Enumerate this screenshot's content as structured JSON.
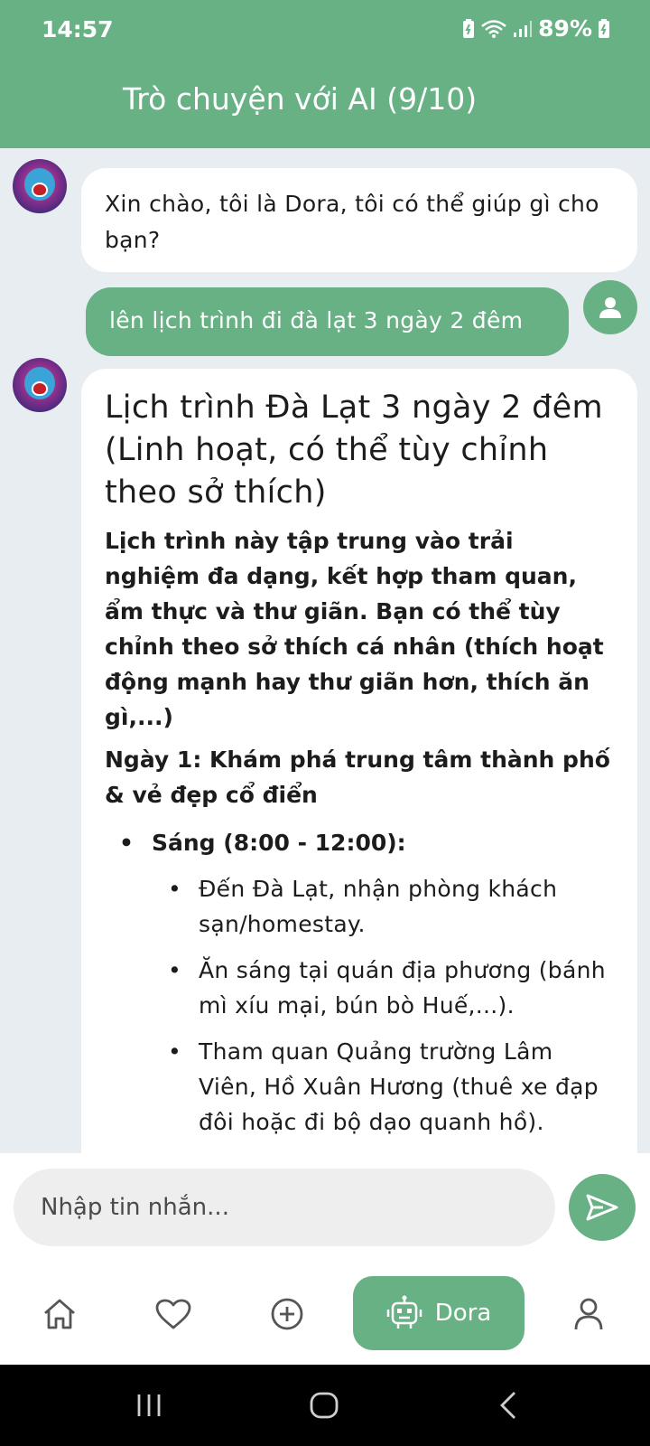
{
  "status_bar": {
    "time": "14:57",
    "battery": "89%"
  },
  "header": {
    "title": "Trò chuyện với AI (9/10)"
  },
  "messages": {
    "bot_greeting": "Xin chào, tôi là Dora, tôi có thể giúp gì cho bạn?",
    "user_message": "lên lịch trình đi đà lạt 3 ngày 2 đêm",
    "bot_reply": {
      "heading": "Lịch trình Đà Lạt 3 ngày 2 đêm (Linh hoạt, có thể tùy chỉnh theo sở thích)",
      "intro": "Lịch trình này tập trung vào trải nghiệm đa dạng, kết hợp tham quan, ẩm thực và thư giãn. Bạn có thể tùy chỉnh theo sở thích cá nhân (thích hoạt động mạnh hay thư giãn hơn, thích ăn gì,...)",
      "day1_title": "Ngày 1: Khám phá trung tâm thành phố & vẻ đẹp cổ điển",
      "morning_label": "Sáng (8:00 - 12:00):",
      "morning_items": [
        "Đến Đà Lạt, nhận phòng khách sạn/homestay.",
        "Ăn sáng tại quán địa phương (bánh mì xíu mại, bún bò Huế,...).",
        "Tham quan Quảng trường Lâm Viên, Hồ Xuân Hương (thuê xe đạp đôi hoặc đi bộ dạo quanh hồ)."
      ]
    }
  },
  "composer": {
    "placeholder": "Nhập tin nhắn..."
  },
  "bottom_nav": {
    "active_label": "Dora"
  },
  "colors": {
    "primary": "#68b184",
    "background": "#e8edf1"
  }
}
